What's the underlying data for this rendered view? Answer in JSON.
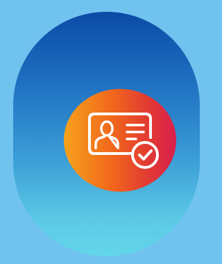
{
  "icon": {
    "name": "id-card-verified-icon",
    "colors": {
      "background": "#71c3ef",
      "tile_gradient": [
        "#0b4aa6",
        "#62d6e8"
      ],
      "badge_gradient": [
        "#f7a21b",
        "#da1f4e"
      ],
      "glyph": "#ffffff"
    }
  }
}
